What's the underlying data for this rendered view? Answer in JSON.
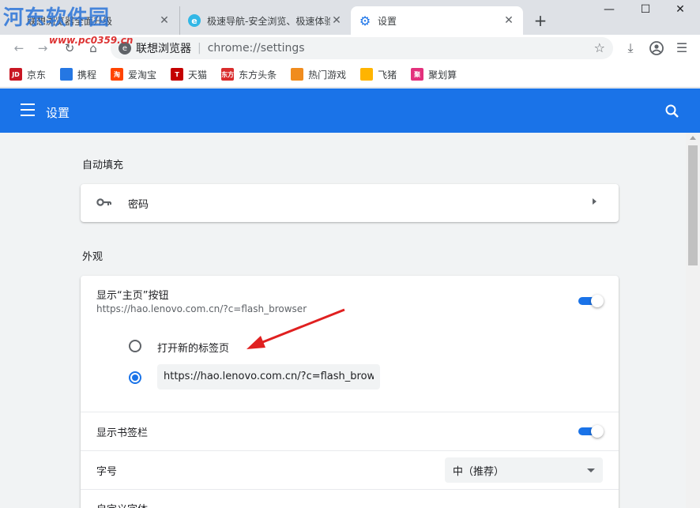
{
  "watermark": {
    "logo": "河东软件园",
    "url": "www.pc0359.cn"
  },
  "tabs": [
    {
      "title": "联想浏览器全面升级",
      "active": false
    },
    {
      "title": "极速导航-安全浏览、极速体验",
      "active": false
    },
    {
      "title": "设置",
      "active": true
    }
  ],
  "window": {
    "minimize": "—",
    "maximize": "☐",
    "close": "✕"
  },
  "omnibox": {
    "brand": "联想浏览器",
    "url": "chrome://settings"
  },
  "bookmarks": [
    {
      "label": "京东",
      "icon_text": "JD",
      "color": "#c91623"
    },
    {
      "label": "携程",
      "icon_text": "",
      "color": "#2577e3"
    },
    {
      "label": "爱淘宝",
      "icon_text": "淘",
      "color": "#ff4400"
    },
    {
      "label": "天猫",
      "icon_text": "T",
      "color": "#c40000"
    },
    {
      "label": "东方头条",
      "icon_text": "东方",
      "color": "#d92c2c"
    },
    {
      "label": "热门游戏",
      "icon_text": "",
      "color": "#f08c1e"
    },
    {
      "label": "飞猪",
      "icon_text": "",
      "color": "#ffb400"
    },
    {
      "label": "聚划算",
      "icon_text": "聚",
      "color": "#e3307c"
    }
  ],
  "header": {
    "title": "设置"
  },
  "autofill": {
    "title": "自动填充",
    "password_label": "密码"
  },
  "appearance": {
    "title": "外观",
    "home_button": {
      "label": "显示“主页”按钮",
      "sub": "https://hao.lenovo.com.cn/?c=flash_browser",
      "enabled": true
    },
    "home_options": {
      "new_tab": "打开新的标签页",
      "custom_url": "https://hao.lenovo.com.cn/?c=flash_browser"
    },
    "bookmarks_bar": {
      "label": "显示书签栏",
      "enabled": true
    },
    "font_size": {
      "label": "字号",
      "value": "中（推荐）"
    },
    "custom_fonts": {
      "label": "自定义字体"
    }
  },
  "colors": {
    "accent": "#1a73e8",
    "annotation": "#e02020"
  }
}
